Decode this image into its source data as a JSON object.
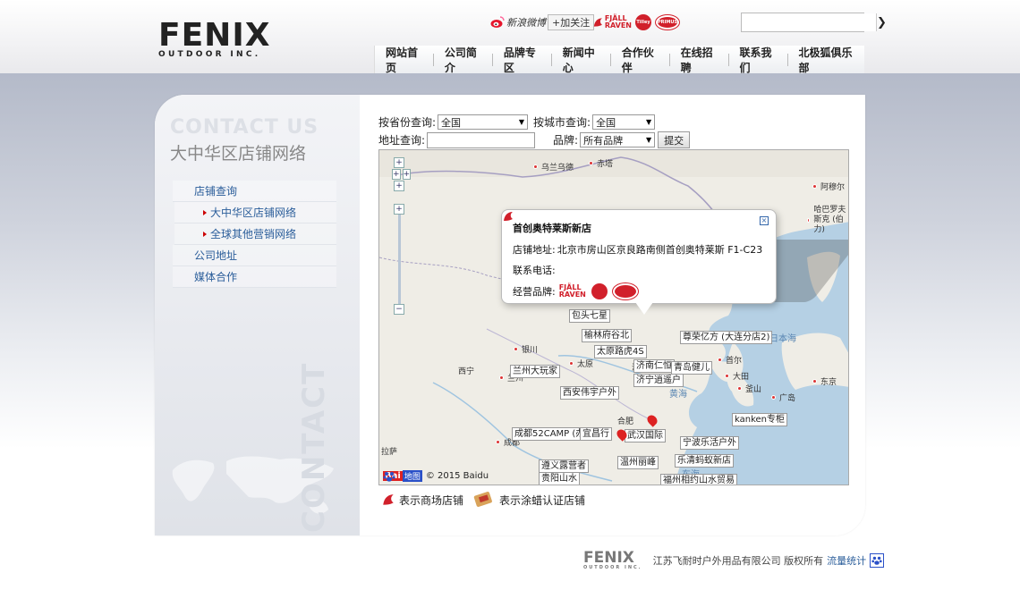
{
  "header": {
    "logo_word": "FENIX",
    "logo_sub": "OUTDOOR INC.",
    "weibo_label": "新浪微博",
    "follow_label": "+加关注",
    "brands": [
      "FJALL RAVEN",
      "Tilley",
      "PRIMUS"
    ],
    "search_placeholder": "",
    "search_button": "❯"
  },
  "nav": {
    "items": [
      "网站首页",
      "公司简介",
      "品牌专区",
      "新闻中心",
      "合作伙伴",
      "在线招聘",
      "联系我们",
      "北极狐俱乐部"
    ]
  },
  "sidebar": {
    "title_en": "CONTACT US",
    "title_cn": "大中华区店铺网络",
    "vertical": "CONTACT",
    "menu": [
      {
        "label": "店铺查询",
        "level": 1
      },
      {
        "label": "大中华区店铺网络",
        "level": 2
      },
      {
        "label": "全球其他营销网络",
        "level": 2
      },
      {
        "label": "公司地址",
        "level": 1
      },
      {
        "label": "媒体合作",
        "level": 1
      }
    ]
  },
  "search_form": {
    "province_label": "按省份查询:",
    "province_value": "全国",
    "city_label": "按城市查询:",
    "city_value": "全国",
    "address_label": "地址查询:",
    "address_value": "",
    "brand_label": "品牌:",
    "brand_value": "所有品牌",
    "submit_label": "提交"
  },
  "map": {
    "cities": [
      "乌兰乌德",
      "赤塔",
      "阿穆尔",
      "哈巴罗夫斯克 (伯力)",
      "银川",
      "西宁",
      "兰州",
      "太原",
      "济南",
      "首尔",
      "大田",
      "釜山",
      "广岛",
      "东京",
      "合肥",
      "成都",
      "拉萨",
      "黄海",
      "日本海",
      "东海"
    ],
    "store_labels": [
      "包头七星",
      "榆林府谷北",
      "太原路虎4S",
      "济南仁恒",
      "青岛健儿",
      "济宁逍遥户",
      "兰州大玩家",
      "西安伟宇户外",
      "尊荣亿方 (大连分店2)",
      "成都52CAMP (办",
      "宜昌行",
      "武汉国际",
      "温州丽峰",
      "遵义露营者",
      "贵阳山水",
      "宁波乐活户外",
      "乐清蚂蚁新店",
      "福州相约山水贸易",
      "kanken专柜"
    ],
    "popup": {
      "title": "首创奥特莱斯新店",
      "address_label": "店铺地址:",
      "address": "北京市房山区京良路南侧首创奥特莱斯 F1-C23",
      "phone_label": "联系电话:",
      "phone": "",
      "brand_label": "经营品牌:"
    },
    "baidu_text": "© 2015 Baidu",
    "baidu_logo": "Bai",
    "baidu_logo_2": "地图"
  },
  "legend": {
    "mall_label": "表示商场店铺",
    "wax_label": "表示涂蜡认证店铺"
  },
  "footer": {
    "logo": "FENIX",
    "logo_sub": "OUTDOOR INC.",
    "copyright": "江苏飞耐时户外用品有限公司 版权所有",
    "stats": "流量统计"
  },
  "colors": {
    "fjallraven_red": "#d1202b",
    "link_blue": "#2a5d9a",
    "band": "#b4bac9"
  }
}
